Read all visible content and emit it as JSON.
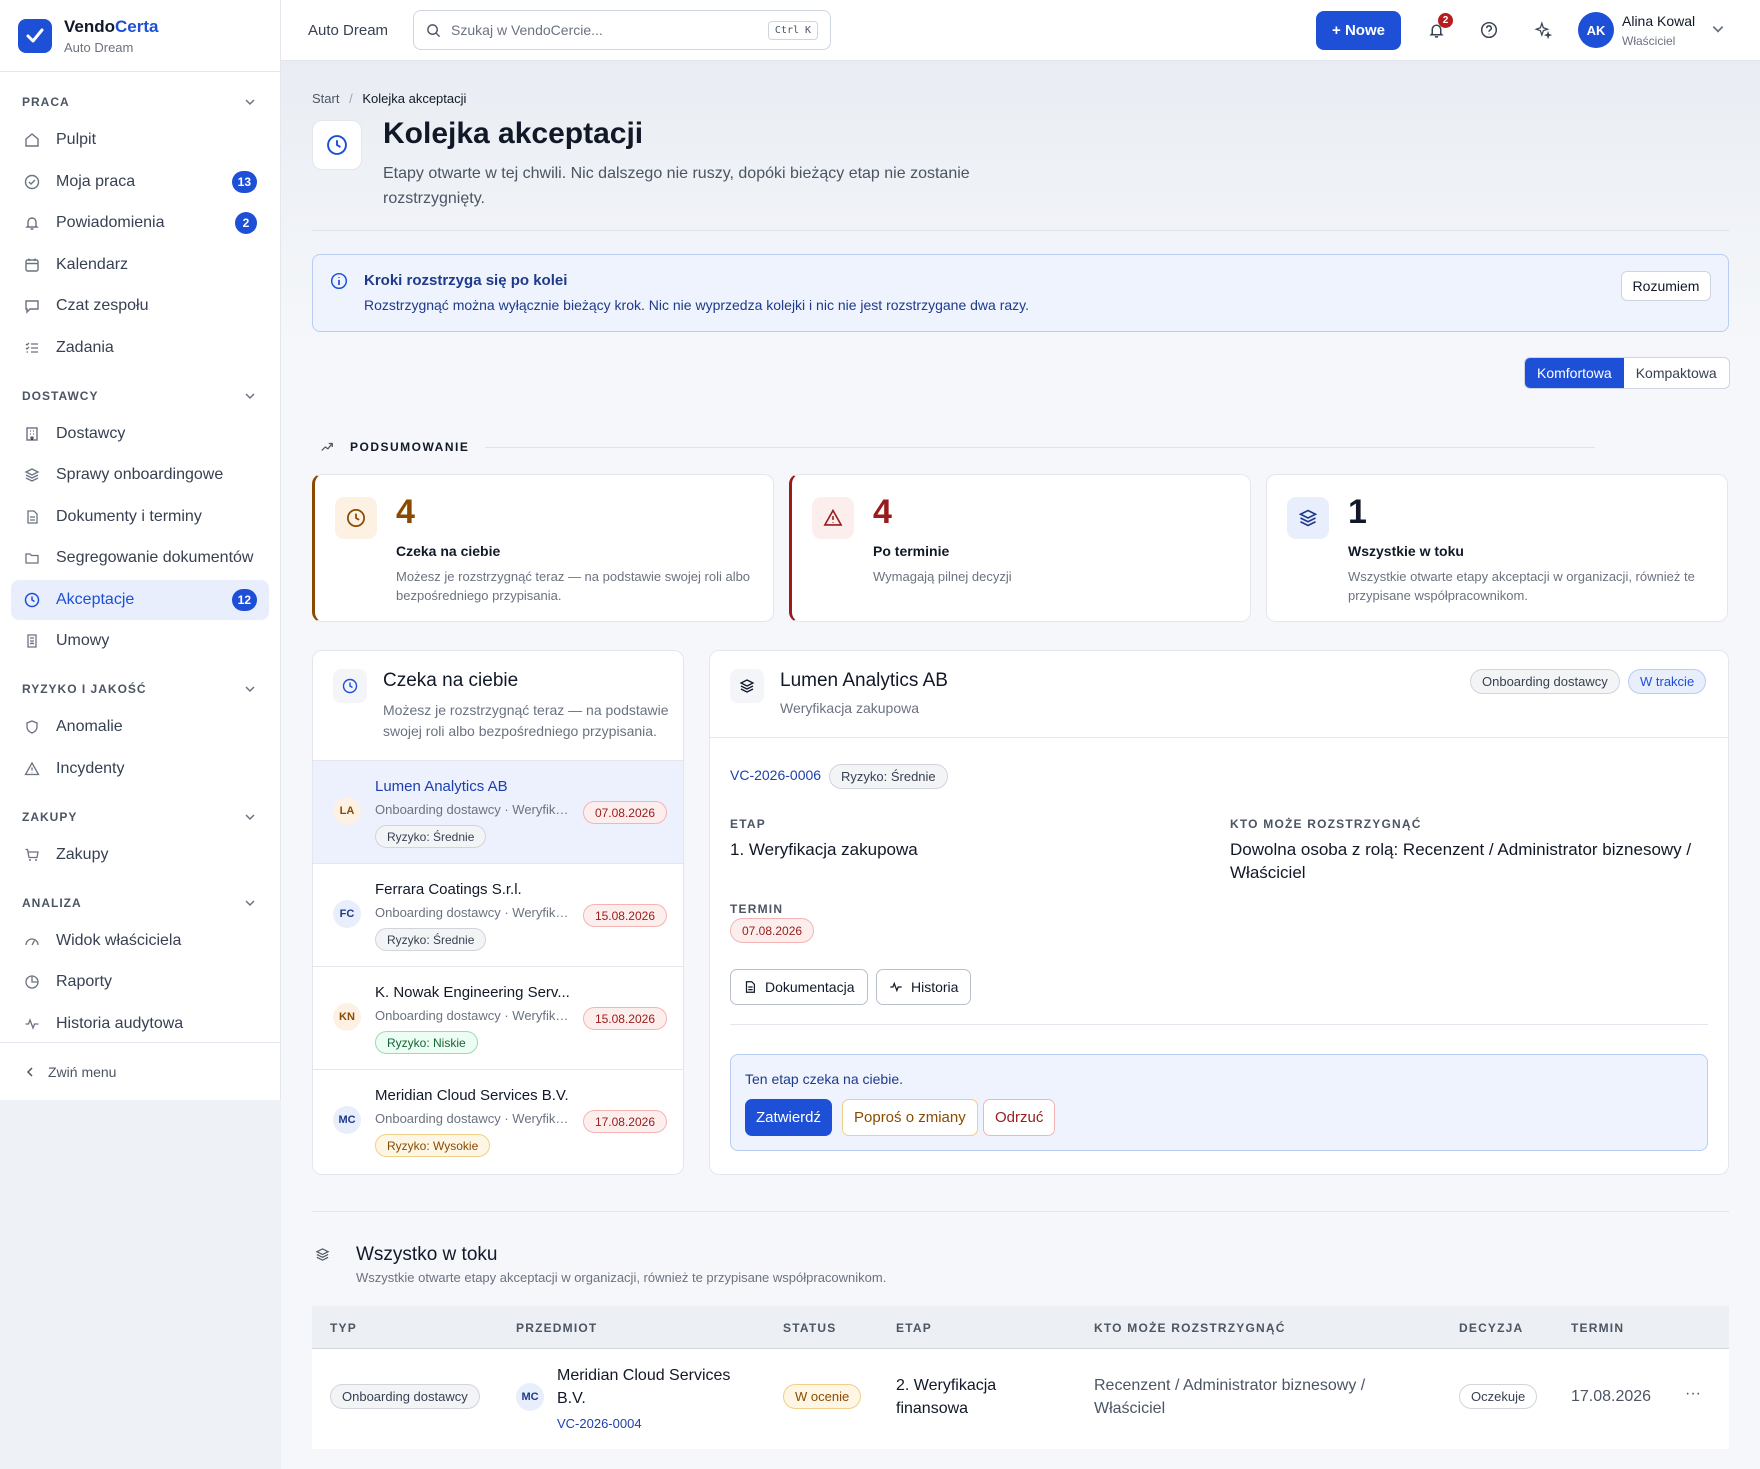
{
  "brand": {
    "name_main": "Vendo",
    "name_accent": "Certa",
    "company": "Auto Dream"
  },
  "sidebar": {
    "sections": [
      {
        "label": "PRACA"
      },
      {
        "label": "DOSTAWCY"
      },
      {
        "label": "RYZYKO I JAKOŚĆ"
      },
      {
        "label": "ZAKUPY"
      },
      {
        "label": "ANALIZA"
      }
    ],
    "items": {
      "pulpit": "Pulpit",
      "moja_praca": "Moja praca",
      "moja_praca_badge": "13",
      "powiadomienia": "Powiadomienia",
      "powiadomienia_badge": "2",
      "kalendarz": "Kalendarz",
      "czat": "Czat zespołu",
      "zadania": "Zadania",
      "dostawcy": "Dostawcy",
      "sprawy": "Sprawy onboardingowe",
      "dokumenty": "Dokumenty i terminy",
      "segregowanie": "Segregowanie dokumentów",
      "akceptacje": "Akceptacje",
      "akceptacje_badge": "12",
      "umowy": "Umowy",
      "anomalie": "Anomalie",
      "incydenty": "Incydenty",
      "zakupy": "Zakupy",
      "widok": "Widok właściciela",
      "raporty": "Raporty",
      "historia": "Historia audytowa"
    },
    "collapse": "Zwiń menu"
  },
  "topbar": {
    "company": "Auto Dream",
    "search_placeholder": "Szukaj w VendoCercie...",
    "shortcut": "Ctrl K",
    "new_button": "+ Nowe",
    "notif_count": "2",
    "user_initials": "AK",
    "user_name": "Alina Kowal",
    "user_role": "Właściciel"
  },
  "page": {
    "crumb_start": "Start",
    "crumb_sep": "/",
    "crumb_current": "Kolejka akceptacji",
    "title": "Kolejka akceptacji",
    "description": "Etapy otwarte w tej chwili. Nic dalszego nie ruszy, dopóki bieżący etap nie zostanie rozstrzygnięty."
  },
  "info": {
    "title": "Kroki rozstrzyga się po kolei",
    "text": "Rozstrzygnąć można wyłącznie bieżący krok. Nic nie wyprzedza kolejki i nic nie jest rozstrzygane dwa razy.",
    "button": "Rozumiem"
  },
  "density": {
    "comfort": "Komfortowa",
    "compact": "Kompaktowa"
  },
  "summary": {
    "heading": "PODSUMOWANIE",
    "cards": [
      {
        "value": "4",
        "label": "Czeka na ciebie",
        "desc": "Możesz je rozstrzygnąć teraz — na podstawie swojej roli albo bezpośredniego przypisania."
      },
      {
        "value": "4",
        "label": "Po terminie",
        "desc": "Wymagają pilnej decyzji"
      },
      {
        "value": "1",
        "label": "Wszystkie w toku",
        "desc": "Wszystkie otwarte etapy akceptacji w organizacji, również te przypisane współpracownikom."
      }
    ]
  },
  "queue": {
    "title": "Czeka na ciebie",
    "desc": "Możesz je rozstrzygnąć teraz — na podstawie swojej roli albo bezpośredniego przypisania.",
    "items": [
      {
        "initials": "LA",
        "name": "Lumen Analytics AB",
        "sub": "Onboarding dostawcy · Weryfikacja zakupowa",
        "risk": "Ryzyko: Średnie",
        "date": "07.08.2026"
      },
      {
        "initials": "FC",
        "name": "Ferrara Coatings S.r.l.",
        "sub": "Onboarding dostawcy · Weryfikacja zakupowa",
        "risk": "Ryzyko: Średnie",
        "date": "15.08.2026"
      },
      {
        "initials": "KN",
        "name": "K. Nowak Engineering Serv...",
        "sub": "Onboarding dostawcy · Weryfikacja zakupowa",
        "risk": "Ryzyko: Niskie",
        "date": "15.08.2026"
      },
      {
        "initials": "MC",
        "name": "Meridian Cloud Services B.V.",
        "sub": "Onboarding dostawcy · Weryfikacja finansowa",
        "risk": "Ryzyko: Wysokie",
        "date": "17.08.2026"
      }
    ]
  },
  "detail": {
    "title": "Lumen Analytics AB",
    "sub": "Weryfikacja zakupowa",
    "pill_type": "Onboarding dostawcy",
    "pill_status": "W trakcie",
    "code": "VC-2026-0006",
    "risk": "Ryzyko: Średnie",
    "stage_label": "ETAP",
    "stage_value": "1. Weryfikacja zakupowa",
    "who_label": "KTO MOŻE ROZSTRZYGNĄĆ",
    "who_value": "Dowolna osoba z rolą: Recenzent / Administrator biznesowy / Właściciel",
    "due_label": "TERMIN",
    "due_value": "07.08.2026",
    "btn_docs": "Dokumentacja",
    "btn_history": "Historia",
    "action_text": "Ten etap czeka na ciebie.",
    "btn_approve": "Zatwierdź",
    "btn_changes": "Poproś o zmiany",
    "btn_reject": "Odrzuć"
  },
  "all": {
    "title": "Wszystko w toku",
    "desc": "Wszystkie otwarte etapy akceptacji w organizacji, również te przypisane współpracownikom.",
    "columns": [
      "TYP",
      "PRZEDMIOT",
      "STATUS",
      "ETAP",
      "KTO MOŻE ROZSTRZYGNĄĆ",
      "DECYZJA",
      "TERMIN"
    ],
    "row": {
      "type": "Onboarding dostawcy",
      "initials": "MC",
      "subject": "Meridian Cloud Services B.V.",
      "code": "VC-2026-0004",
      "status": "W ocenie",
      "stage": "2. Weryfikacja finansowa",
      "who": "Recenzent / Administrator biznesowy / Właściciel",
      "decision": "Oczekuje",
      "due": "17.08.2026",
      "more": "···"
    }
  },
  "colors": {
    "accent": "#1d4fd7",
    "waiting": "#8a4b00",
    "overdue": "#991b1b",
    "ok": "#166534"
  }
}
